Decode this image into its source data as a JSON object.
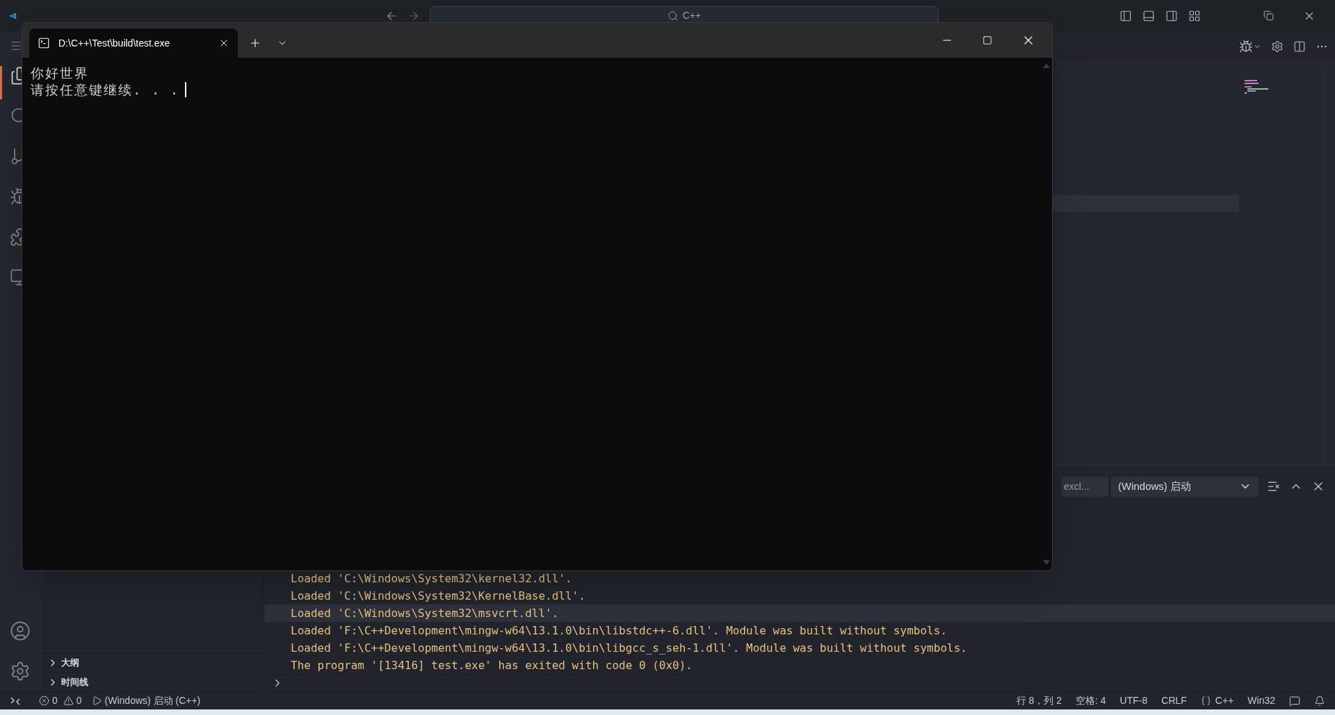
{
  "titlebar": {
    "search": "C++"
  },
  "terminal": {
    "tab_title": "D:\\C++\\Test\\build\\test.exe",
    "lines": [
      "你好世界",
      "请按任意键继续. . ."
    ]
  },
  "sidebar": {
    "sections": [
      {
        "label": "大纲",
        "expanded": false
      },
      {
        "label": "时间线",
        "expanded": false
      }
    ]
  },
  "panel": {
    "filter_placeholder": "excl...",
    "launch_config": "(Windows) 启动",
    "console_lines": [
      {
        "text": "Loaded 'C:\\Windows\\System32\\kernel32.dll'.",
        "selected": false
      },
      {
        "text": "Loaded 'C:\\Windows\\System32\\KernelBase.dll'.",
        "selected": false
      },
      {
        "text": "Loaded 'C:\\Windows\\System32\\msvcrt.dll'.",
        "selected": true
      },
      {
        "text": "Loaded 'F:\\C++Development\\mingw-w64\\13.1.0\\bin\\libstdc++-6.dll'. Module was built without symbols.",
        "selected": false
      },
      {
        "text": "Loaded 'F:\\C++Development\\mingw-w64\\13.1.0\\bin\\libgcc_s_seh-1.dll'. Module was built without symbols.",
        "selected": false
      },
      {
        "text": "The program '[13416] test.exe' has exited with code 0 (0x0).",
        "selected": false
      }
    ]
  },
  "status_bar": {
    "errors": "0",
    "warnings": "0",
    "launch": "(Windows) 启动 (C++)",
    "right_items": [
      {
        "kind": "text",
        "label": "行 8，列 2"
      },
      {
        "kind": "text",
        "label": "空格: 4"
      },
      {
        "kind": "text",
        "label": "UTF-8"
      },
      {
        "kind": "text",
        "label": "CRLF"
      },
      {
        "kind": "language",
        "label": "C++"
      },
      {
        "kind": "text",
        "label": "Win32"
      }
    ]
  }
}
